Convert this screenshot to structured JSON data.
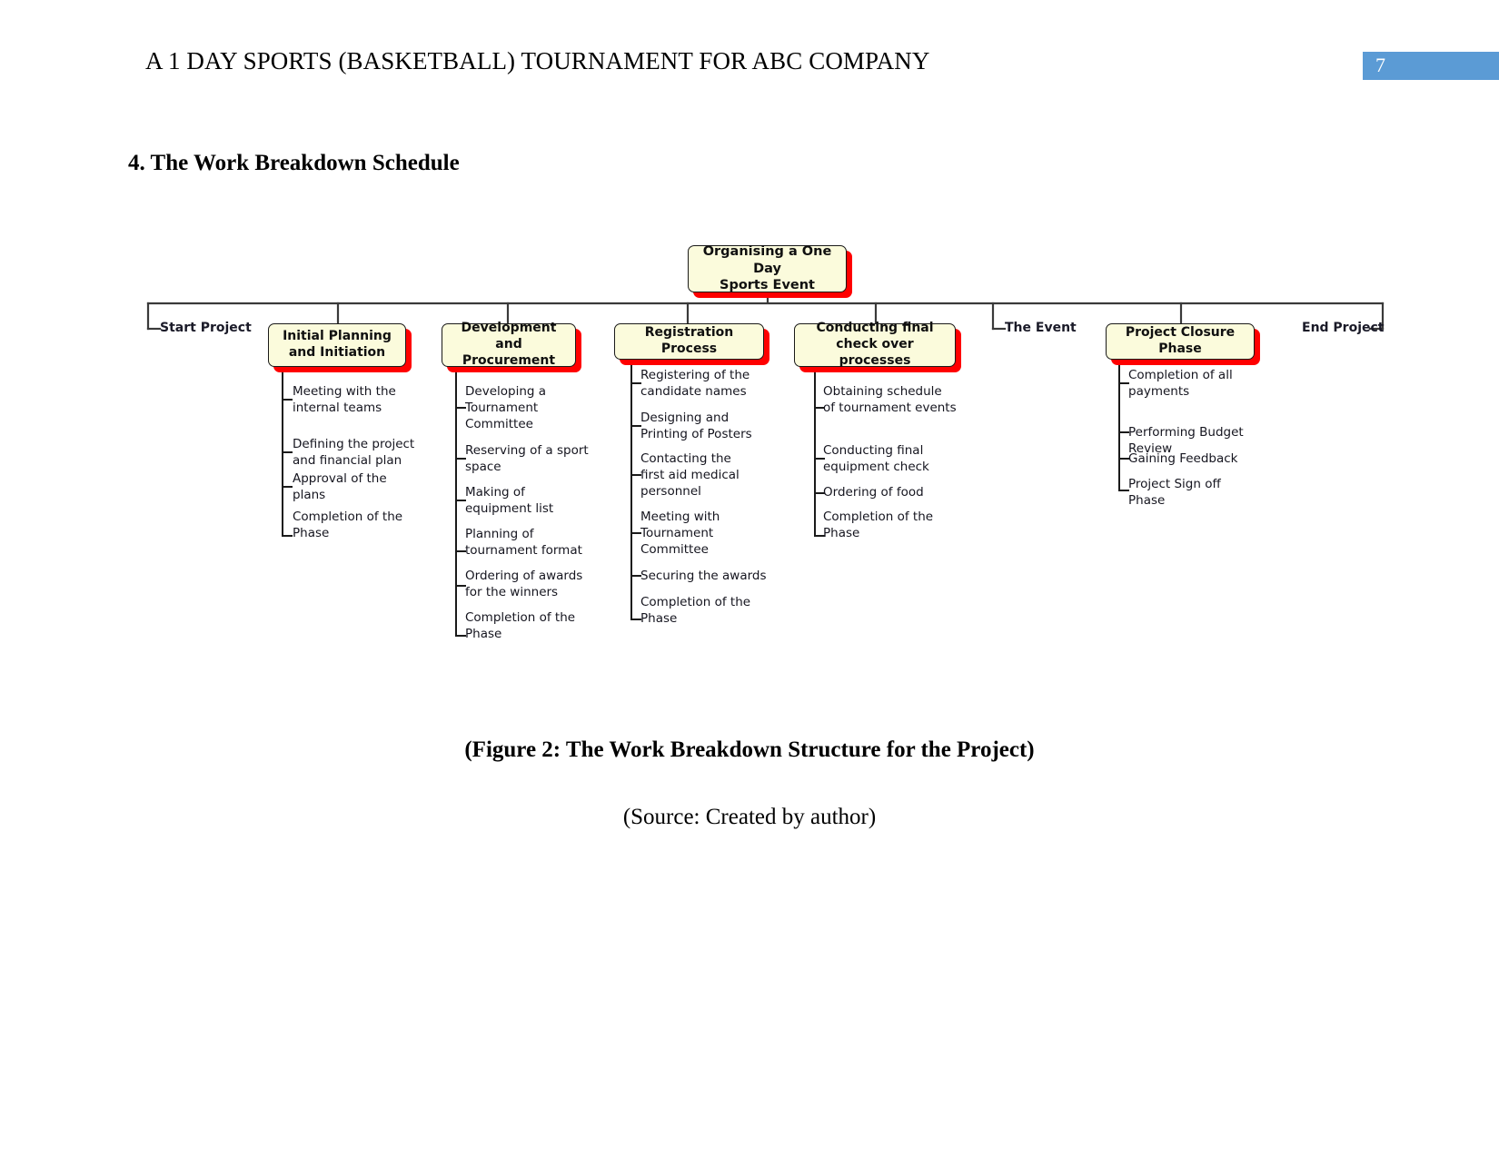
{
  "header": {
    "title": "A 1 DAY SPORTS (BASKETBALL) TOURNAMENT FOR ABC COMPANY",
    "page_number": "7",
    "badge_color": "#5b9bd5"
  },
  "section": {
    "heading": "4. The Work Breakdown Schedule"
  },
  "diagram": {
    "root": {
      "label": "Organising a One Day\nSports Event"
    },
    "milestones": [
      {
        "label": "Start Project"
      },
      {
        "label": "The Event"
      },
      {
        "label": "End Project"
      }
    ],
    "phases": [
      {
        "label": "Initial Planning and Initiation",
        "tasks": [
          "Meeting with the internal teams",
          "Defining the project and financial plan",
          "Approval of the plans",
          "Completion of the Phase"
        ]
      },
      {
        "label": "Development and Procurement",
        "tasks": [
          "Developing a Tournament Committee",
          "Reserving of a sport space",
          "Making of equipment list",
          "Planning of tournament format",
          "Ordering of awards for the winners",
          "Completion of the Phase"
        ]
      },
      {
        "label": "Registration Process",
        "tasks": [
          "Registering of the candidate names",
          "Designing and Printing of Posters",
          "Contacting the first aid medical personnel",
          "Meeting with Tournament Committee",
          "Securing the awards",
          "Completion of the Phase"
        ]
      },
      {
        "label": "Conducting final check over processes",
        "tasks": [
          "Obtaining schedule of tournament events",
          "Conducting final equipment check",
          "Ordering of food",
          "Completion of the Phase"
        ]
      },
      {
        "label": "Project Closure Phase",
        "tasks": [
          "Completion of all payments",
          "Performing Budget Review",
          "Gaining Feedback",
          "Project Sign off Phase"
        ]
      }
    ],
    "node_fill": "#fbfbdc",
    "node_border": "#1a1a1a",
    "node_shadow": "#ff0000",
    "line_color": "#3a3a3a"
  },
  "caption": "(Figure 2: The Work Breakdown Structure for the Project)",
  "source": "(Source: Created by author)"
}
